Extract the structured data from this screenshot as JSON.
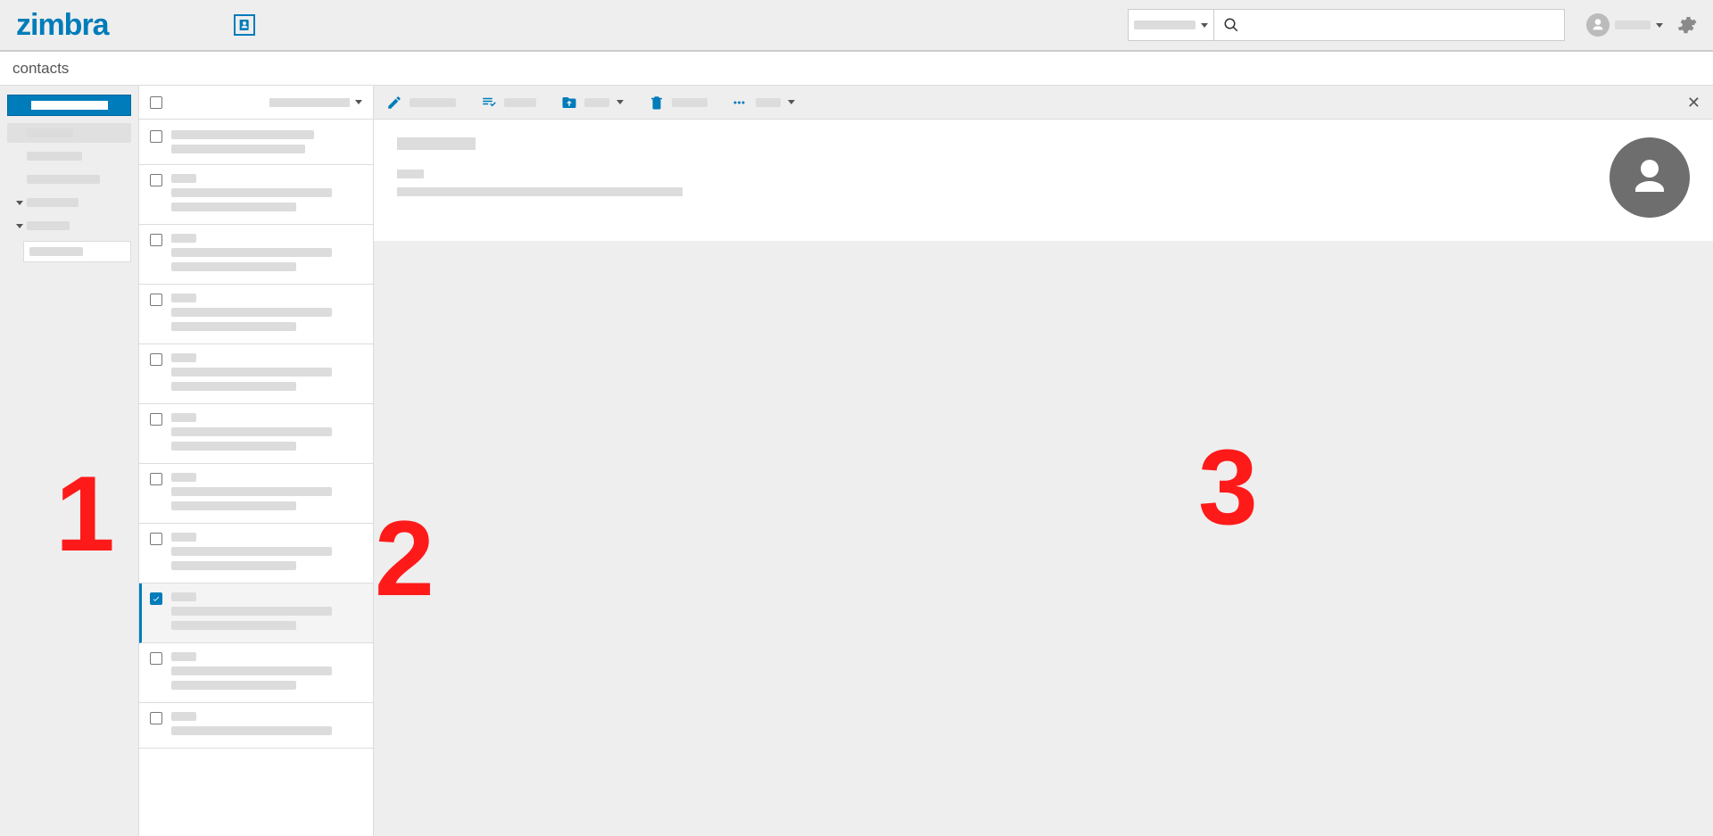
{
  "brand": "zimbra",
  "context_label": "contacts",
  "header": {
    "app_icon": "contacts-icon",
    "search_scope_label": "",
    "search_value": "",
    "user_name": "",
    "settings_title": "Settings"
  },
  "sidebar": {
    "new_button_label": "",
    "nav": [
      {
        "type": "item",
        "selected": true,
        "width": "np1"
      },
      {
        "type": "item",
        "selected": false,
        "width": "np2"
      },
      {
        "type": "item",
        "selected": false,
        "width": "np3"
      },
      {
        "type": "collapsible",
        "expanded": true,
        "width": "np4"
      },
      {
        "type": "collapsible",
        "expanded": true,
        "width": "np5"
      },
      {
        "type": "tag-input"
      }
    ]
  },
  "list": {
    "sort_label": "",
    "contacts": [
      {
        "name": "",
        "lines": 2,
        "checked": false,
        "first": true
      },
      {
        "name": "",
        "lines": 3,
        "checked": false
      },
      {
        "name": "",
        "lines": 3,
        "checked": false
      },
      {
        "name": "",
        "lines": 3,
        "checked": false
      },
      {
        "name": "",
        "lines": 3,
        "checked": false
      },
      {
        "name": "",
        "lines": 3,
        "checked": false
      },
      {
        "name": "",
        "lines": 3,
        "checked": false
      },
      {
        "name": "",
        "lines": 3,
        "checked": false
      },
      {
        "name": "",
        "lines": 3,
        "checked": true,
        "selected": true
      },
      {
        "name": "",
        "lines": 3,
        "checked": false
      },
      {
        "name": "",
        "lines": 2,
        "checked": false
      }
    ]
  },
  "toolbar": {
    "items": [
      {
        "icon": "edit",
        "label": "",
        "has_caret": false,
        "w": "tbl1"
      },
      {
        "icon": "assign",
        "label": "",
        "has_caret": false,
        "w": "tbl2"
      },
      {
        "icon": "move",
        "label": "",
        "has_caret": true,
        "w": "tbl3"
      },
      {
        "icon": "delete",
        "label": "",
        "has_caret": false,
        "w": "tbl4"
      },
      {
        "icon": "more",
        "label": "",
        "has_caret": true,
        "w": "tbl5"
      }
    ]
  },
  "detail": {
    "name": "",
    "subtitle": "",
    "body": ""
  },
  "overlays": {
    "one": "1",
    "two": "2",
    "three": "3"
  }
}
